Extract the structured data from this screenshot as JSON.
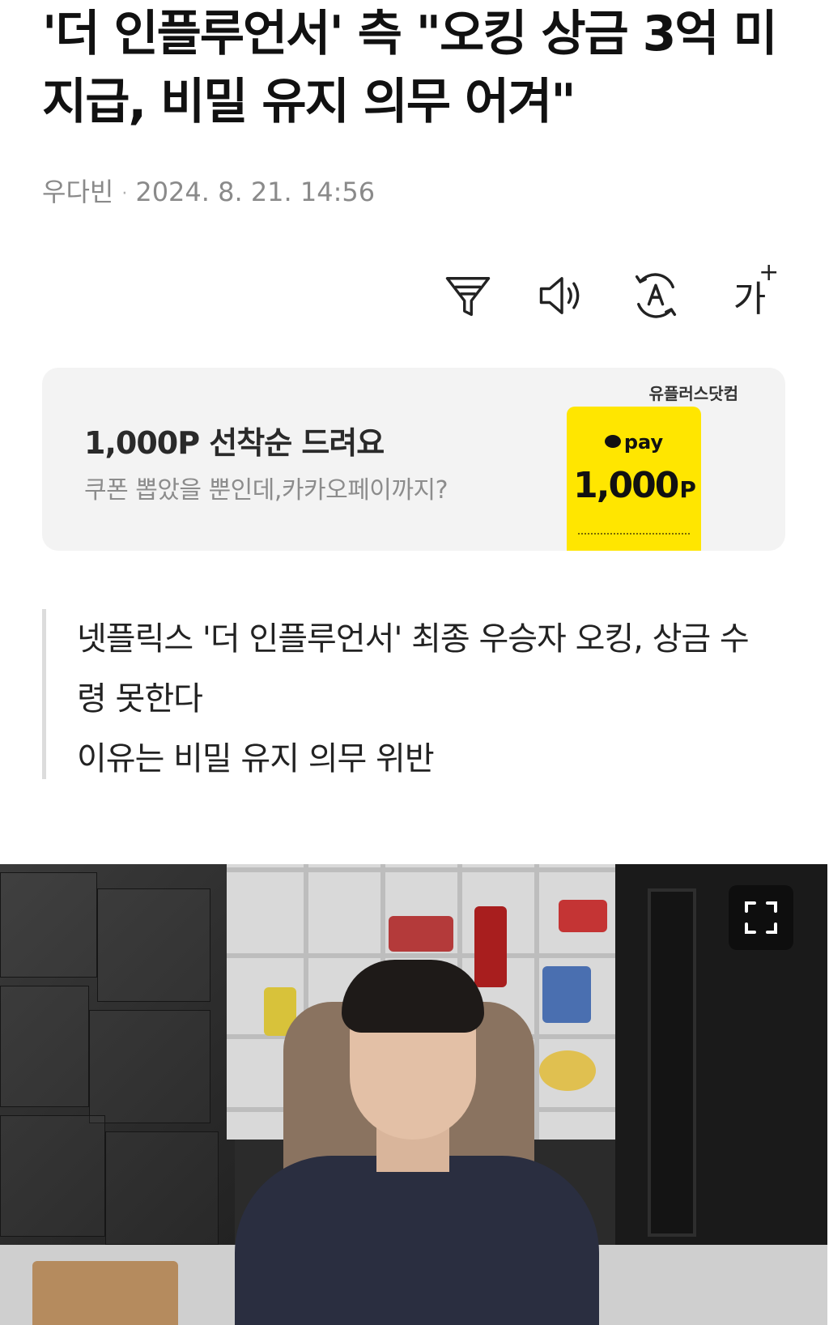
{
  "article": {
    "headline": "'더 인플루언서' 측 \"오킹 상금 3억 미지급, 비밀 유지 의무 어겨\"",
    "author": "우다빈",
    "separator": "·",
    "published": "2024. 8. 21. 14:56"
  },
  "toolbar": {
    "summary_icon": "funnel-icon",
    "listen_icon": "speaker-icon",
    "translate_icon": "translate-icon",
    "font_size_label": "가",
    "font_size_plus": "+"
  },
  "ad": {
    "brand": "유플러스닷컴",
    "title": "1,000P 선착순 드려요",
    "subtitle": "쿠폰 뽑았을 뿐인데,카카오페이까지?",
    "coupon_pay": "pay",
    "coupon_amount": "1,000",
    "coupon_unit": "P",
    "coupon_color": "#ffe600"
  },
  "summary": {
    "lines": [
      "넷플릭스 '더 인플루언서' 최종 우승자 오킹, 상금 수령 못한다",
      "이유는 비밀 유지 의무 위반"
    ]
  },
  "video": {
    "fullscreen_icon": "fullscreen-icon"
  }
}
